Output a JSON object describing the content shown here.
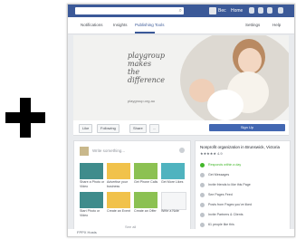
{
  "colors": {
    "brand_blue": "#3b5998",
    "signup_blue": "#4267b2",
    "green": "#42b72a"
  },
  "topbar": {
    "search_icon": "magnifier-icon",
    "user": "Bec",
    "home": "Home"
  },
  "tabs": [
    "Notifications",
    "Insights",
    "Publishing Tools",
    "Settings",
    "Help"
  ],
  "cover": {
    "brand_lines": [
      "playgroup",
      "makes",
      "the",
      "difference"
    ],
    "url": "playgroup.org.au"
  },
  "actions": {
    "like": "Like",
    "following": "Following",
    "share": "Share",
    "more": "...",
    "signup": "Sign Up"
  },
  "composer": {
    "placeholder": "Write something...",
    "cards": [
      {
        "label": "Share a Photo or Video"
      },
      {
        "label": "Advertise your business"
      },
      {
        "label": "Get Phone Calls"
      },
      {
        "label": "Get More Likes"
      },
      {
        "label": "Start Photo or Video"
      },
      {
        "label": "Create an Event"
      },
      {
        "label": "Create an Offer"
      },
      {
        "label": "Write a Note"
      }
    ],
    "see_all": "See all"
  },
  "side": {
    "title": "Nonprofit organization in Brunswick, Victoria",
    "rating": "★★★★★ 4.9",
    "rows": [
      {
        "text": "Responds within a day",
        "green": true
      },
      {
        "text": "Get Messages",
        "green": false
      },
      {
        "text": "Invite friends to like this Page",
        "green": false
      },
      {
        "text": "See Pages Feed",
        "green": false
      },
      {
        "text": "Posts from Pages you've liked",
        "green": false
      },
      {
        "text": "Invite Partners & Clients",
        "green": false
      },
      {
        "text": "61 people like this",
        "green": false
      }
    ]
  },
  "bottom": {
    "text": "FPPX Hosts"
  }
}
